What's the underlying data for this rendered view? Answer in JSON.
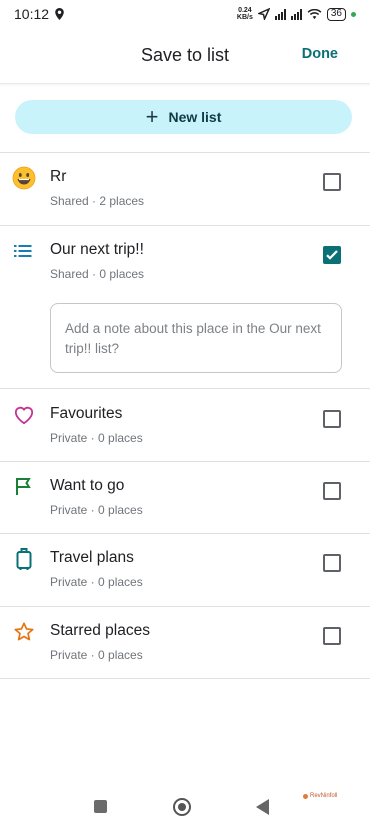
{
  "status_bar": {
    "time": "10:12",
    "net_speed_top": "0.24",
    "net_speed_bottom": "KB/s",
    "battery": "36"
  },
  "header": {
    "title": "Save to list",
    "done_label": "Done"
  },
  "new_list": {
    "label": "New list"
  },
  "lists": [
    {
      "name": "Rr",
      "subtitle": "Shared · 2 places",
      "icon": "smiley-emoji-icon",
      "checked": false
    },
    {
      "name": "Our next trip!!",
      "subtitle": "Shared · 0 places",
      "icon": "list-icon",
      "checked": true
    },
    {
      "name": "Favourites",
      "subtitle": "Private · 0 places",
      "icon": "heart-icon",
      "checked": false
    },
    {
      "name": "Want to go",
      "subtitle": "Private · 0 places",
      "icon": "flag-icon",
      "checked": false
    },
    {
      "name": "Travel plans",
      "subtitle": "Private · 0 places",
      "icon": "suitcase-icon",
      "checked": false
    },
    {
      "name": "Starred places",
      "subtitle": "Private · 0 places",
      "icon": "star-icon",
      "checked": false
    }
  ],
  "note": {
    "placeholder": "Add a note about this place in the Our next trip!! list?"
  },
  "watermark": {
    "text": "RevNinfoll"
  },
  "colors": {
    "accent": "#0b7075",
    "new_list_bg": "#c9f3fb",
    "heart": "#c2378f",
    "flag": "#188038",
    "star": "#e8710a"
  }
}
